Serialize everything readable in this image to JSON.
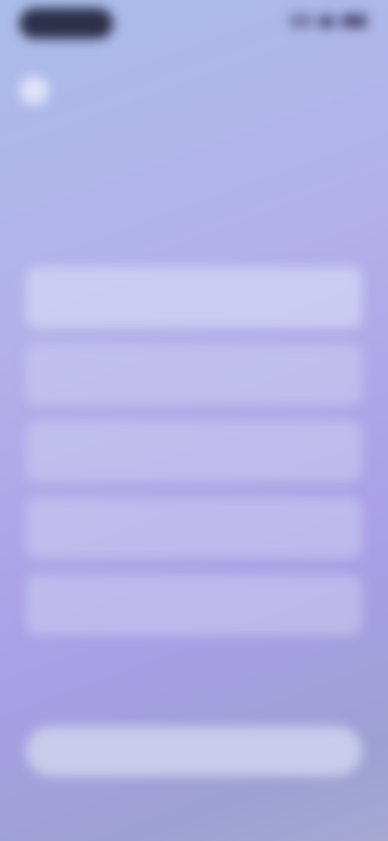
{
  "status_bar": {
    "time": ""
  },
  "header": {
    "brand_name": ""
  },
  "question": {
    "title": "",
    "hint": ""
  },
  "options": [
    {
      "label": ""
    },
    {
      "label": ""
    },
    {
      "label": ""
    },
    {
      "label": ""
    },
    {
      "label": ""
    }
  ],
  "cta": {
    "label": ""
  },
  "colors": {
    "background_top": "#a9bde9",
    "background_mid": "#a99fe6",
    "option_fill": "#cdcdf0",
    "cta_fill": "#c9cbeb",
    "title_text": "#3e3f72"
  }
}
